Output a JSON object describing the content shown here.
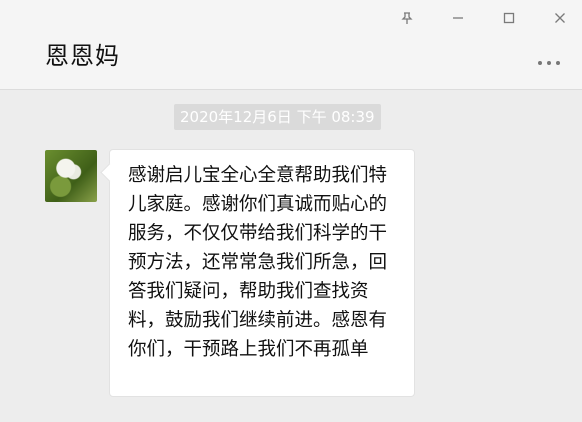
{
  "window": {
    "pin_icon": "pin-icon",
    "minimize_icon": "minimize-icon",
    "maximize_icon": "maximize-icon",
    "close_icon": "close-icon"
  },
  "chat": {
    "title": "恩恩妈",
    "more_icon": "more-icon"
  },
  "messages": [
    {
      "timestamp": "2020年12月6日 下午 08:39",
      "text": "感谢启儿宝全心全意帮助我们特儿家庭。感谢你们真诚而贴心的服务，不仅仅带给我们科学的干预方法，还常常急我们所急，回答我们疑问，帮助我们查找资料，鼓励我们继续前进。感恩有你们，干预路上我们不再孤单"
    }
  ],
  "colors": {
    "background": "#ededed",
    "bubble": "#ffffff",
    "timestamp_bg": "#dadada"
  }
}
